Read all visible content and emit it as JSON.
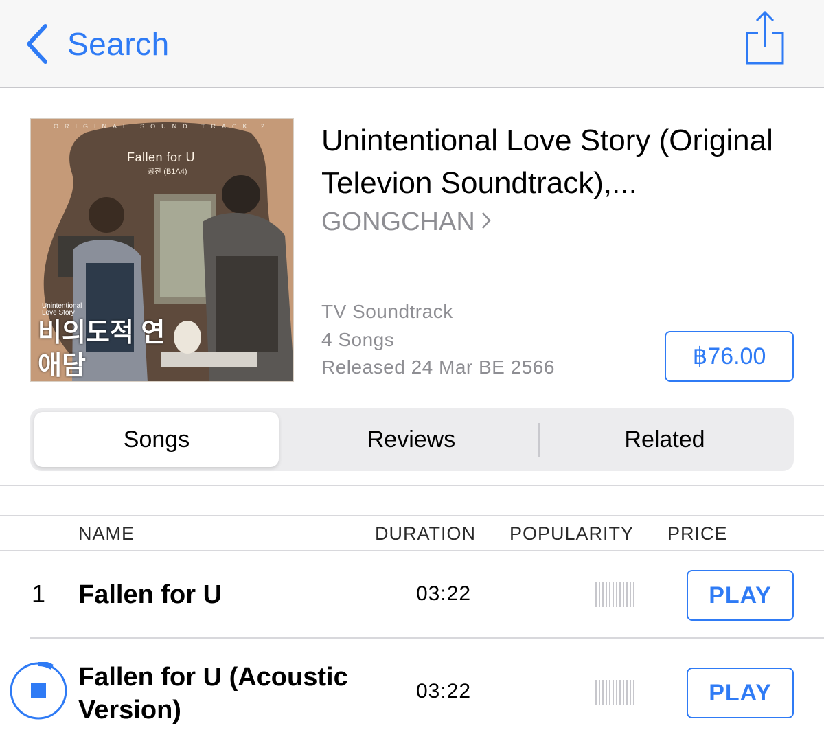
{
  "nav": {
    "back_label": "Search",
    "icons": {
      "back": "chevron-left-icon",
      "share": "share-icon"
    }
  },
  "album": {
    "artwork_text": {
      "top": "ORIGINAL SOUND TRACK 2",
      "song": "Fallen for U",
      "artist": "공찬 (B1A4)",
      "title_en": "Unintentional Love Story",
      "title_kr": "비의도적 연애담"
    },
    "title": "Unintentional Love Story (Original Televion Soundtrack),...",
    "artist": "GONGCHAN",
    "genre": "TV Soundtrack",
    "song_count": "4 Songs",
    "released": "Released 24 Mar BE 2566",
    "price": "฿76.00"
  },
  "tabs": [
    {
      "label": "Songs",
      "active": true
    },
    {
      "label": "Reviews",
      "active": false
    },
    {
      "label": "Related",
      "active": false
    }
  ],
  "table": {
    "headers": {
      "name": "NAME",
      "duration": "DURATION",
      "popularity": "POPULARITY",
      "price": "PRICE"
    },
    "rows": [
      {
        "number": "1",
        "name": "Fallen for U",
        "duration": "03:22",
        "action": "PLAY",
        "state": "idle"
      },
      {
        "number": "",
        "name": "Fallen for U (Acoustic Version)",
        "duration": "03:22",
        "action": "PLAY",
        "state": "playing-preview"
      }
    ]
  },
  "colors": {
    "accent": "#2f7bf5",
    "secondary_text": "#8e8e93",
    "nav_bg": "#f7f7f7"
  }
}
